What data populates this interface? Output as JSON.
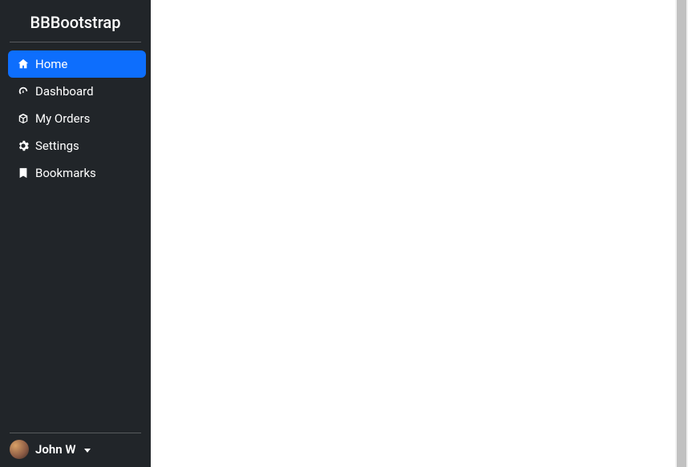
{
  "brand": "BBBootstrap",
  "colors": {
    "sidebar_bg": "#212529",
    "active_bg": "#0d6efd",
    "text": "#ffffff"
  },
  "nav": {
    "items": [
      {
        "label": "Home",
        "icon": "home-icon",
        "active": true
      },
      {
        "label": "Dashboard",
        "icon": "speedometer-icon",
        "active": false
      },
      {
        "label": "My Orders",
        "icon": "box-icon",
        "active": false
      },
      {
        "label": "Settings",
        "icon": "gear-icon",
        "active": false
      },
      {
        "label": "Bookmarks",
        "icon": "bookmark-icon",
        "active": false
      }
    ]
  },
  "user": {
    "name": "John W"
  }
}
